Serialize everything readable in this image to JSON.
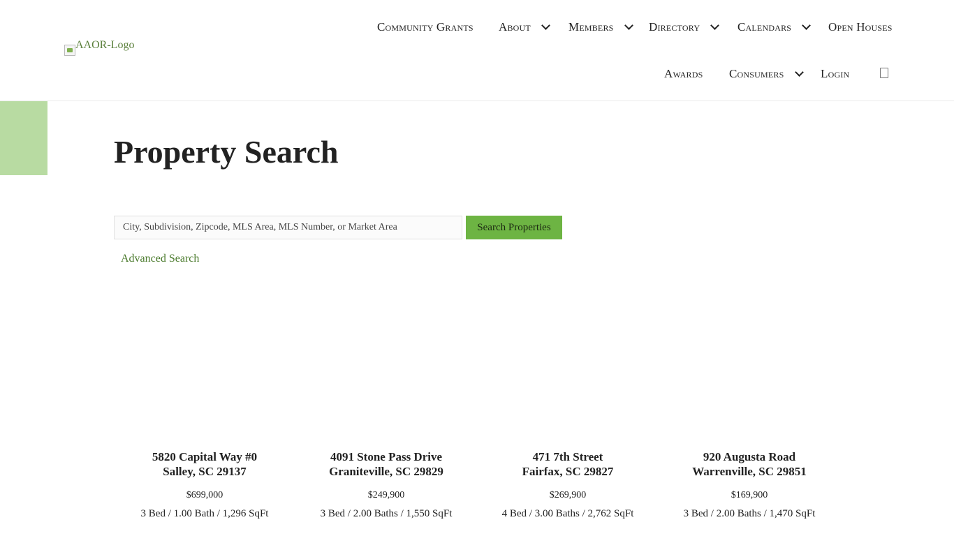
{
  "logo": {
    "alt": "AAOR-Logo"
  },
  "nav": {
    "row1": [
      {
        "label": "Community Grants"
      },
      {
        "label": "About"
      },
      {
        "label": "Members"
      },
      {
        "label": "Directory"
      },
      {
        "label": "Calendars"
      },
      {
        "label": "Open Houses"
      }
    ],
    "row2": [
      {
        "label": "Awards"
      },
      {
        "label": "Consumers"
      },
      {
        "label": "Login"
      }
    ],
    "search_icon": "search-icon"
  },
  "page": {
    "title": "Property Search"
  },
  "search": {
    "placeholder": "City, Subdivision, Zipcode, MLS Area, MLS Number, or Market Area",
    "value": "",
    "button_label": "Search Properties",
    "advanced_label": "Advanced Search"
  },
  "listings": [
    {
      "address": "5820 Capital Way #0",
      "city": "Salley, SC 29137",
      "price": "$699,000",
      "details": "3 Bed / 1.00 Bath / 1,296 SqFt"
    },
    {
      "address": "4091 Stone Pass Drive",
      "city": "Graniteville, SC 29829",
      "price": "$249,900",
      "details": "3 Bed / 2.00 Baths / 1,550 SqFt"
    },
    {
      "address": "471 7th Street",
      "city": "Fairfax, SC 29827",
      "price": "$269,900",
      "details": "4 Bed / 3.00 Baths / 2,762 SqFt"
    },
    {
      "address": "920 Augusta Road",
      "city": "Warrenville, SC 29851",
      "price": "$169,900",
      "details": "3 Bed / 2.00 Baths / 1,470 SqFt"
    }
  ],
  "colors": {
    "accent": "#6db443",
    "block": "#b8dba2",
    "link": "#4a7a2c"
  }
}
